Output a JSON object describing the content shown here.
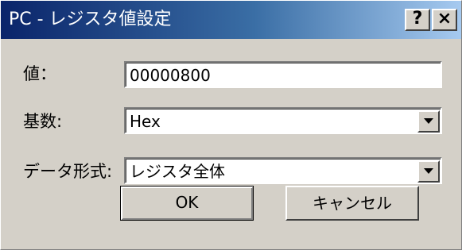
{
  "window": {
    "title": "PC - レジスタ値設定",
    "help_label": "?",
    "close_label": "×"
  },
  "form": {
    "value_label": "値：",
    "value": "00000800",
    "radix_label": "基数:",
    "radix_selected": "Hex",
    "format_label": "データ形式:",
    "format_selected": "レジスタ全体"
  },
  "buttons": {
    "ok": "OK",
    "cancel": "キャンセル"
  }
}
